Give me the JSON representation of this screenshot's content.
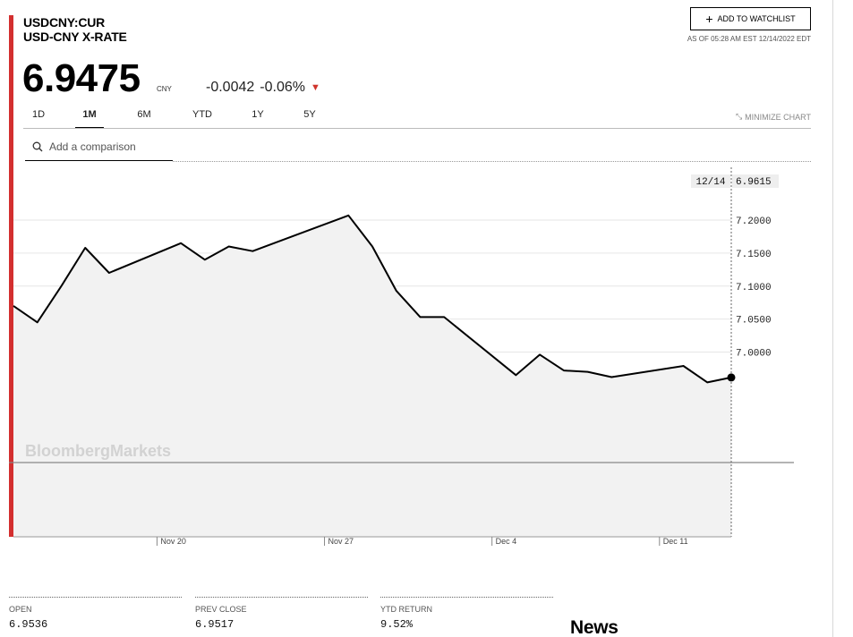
{
  "header": {
    "ticker": "USDCNY:CUR",
    "name": "USD-CNY X-RATE",
    "watchlist_label": "ADD TO WATCHLIST",
    "as_of": "AS OF 05:28 AM EST 12/14/2022 EDT"
  },
  "quote": {
    "price": "6.9475",
    "currency": "CNY",
    "change": "-0.0042",
    "change_pct": "-0.06%"
  },
  "tabs": [
    {
      "label": "1D",
      "active": false
    },
    {
      "label": "1M",
      "active": true
    },
    {
      "label": "6M",
      "active": false
    },
    {
      "label": "YTD",
      "active": false
    },
    {
      "label": "1Y",
      "active": false
    },
    {
      "label": "5Y",
      "active": false
    }
  ],
  "minimize_label": "MINIMIZE CHART",
  "compare": {
    "placeholder": "Add a comparison"
  },
  "colors": {
    "accent": "#d32f2f",
    "negative": "#d0342c",
    "line": "#000000",
    "area": "#f2f2f2"
  },
  "chart_data": {
    "type": "area",
    "watermark": "BloombergMarkets",
    "cursor": {
      "date": "12/14",
      "value": "6.9615"
    },
    "x_ticks": [
      "Nov 20",
      "Nov 27",
      "Dec 4",
      "Dec 11"
    ],
    "y_ticks": [
      "7.2000",
      "7.1500",
      "7.1000",
      "7.0500",
      "7.0000"
    ],
    "ylim": [
      6.72,
      7.28
    ],
    "grid": true,
    "series": [
      {
        "values": [
          {
            "x": "2022-11-14",
            "y": 7.07
          },
          {
            "x": "2022-11-15",
            "y": 7.045
          },
          {
            "x": "2022-11-16",
            "y": 7.1
          },
          {
            "x": "2022-11-17",
            "y": 7.158
          },
          {
            "x": "2022-11-18",
            "y": 7.12
          },
          {
            "x": "2022-11-21",
            "y": 7.165
          },
          {
            "x": "2022-11-22",
            "y": 7.14
          },
          {
            "x": "2022-11-23",
            "y": 7.16
          },
          {
            "x": "2022-11-24",
            "y": 7.153
          },
          {
            "x": "2022-11-28",
            "y": 7.207
          },
          {
            "x": "2022-11-29",
            "y": 7.16
          },
          {
            "x": "2022-11-30",
            "y": 7.093
          },
          {
            "x": "2022-12-01",
            "y": 7.053
          },
          {
            "x": "2022-12-02",
            "y": 7.053
          },
          {
            "x": "2022-12-05",
            "y": 6.965
          },
          {
            "x": "2022-12-06",
            "y": 6.996
          },
          {
            "x": "2022-12-07",
            "y": 6.972
          },
          {
            "x": "2022-12-08",
            "y": 6.97
          },
          {
            "x": "2022-12-09",
            "y": 6.962
          },
          {
            "x": "2022-12-12",
            "y": 6.979
          },
          {
            "x": "2022-12-13",
            "y": 6.954
          },
          {
            "x": "2022-12-14",
            "y": 6.9615
          }
        ]
      }
    ]
  },
  "stats": [
    {
      "label": "OPEN",
      "value": "6.9536"
    },
    {
      "label": "PREV CLOSE",
      "value": "6.9517"
    },
    {
      "label": "YTD RETURN",
      "value": "9.52%"
    }
  ],
  "news_heading": "News"
}
